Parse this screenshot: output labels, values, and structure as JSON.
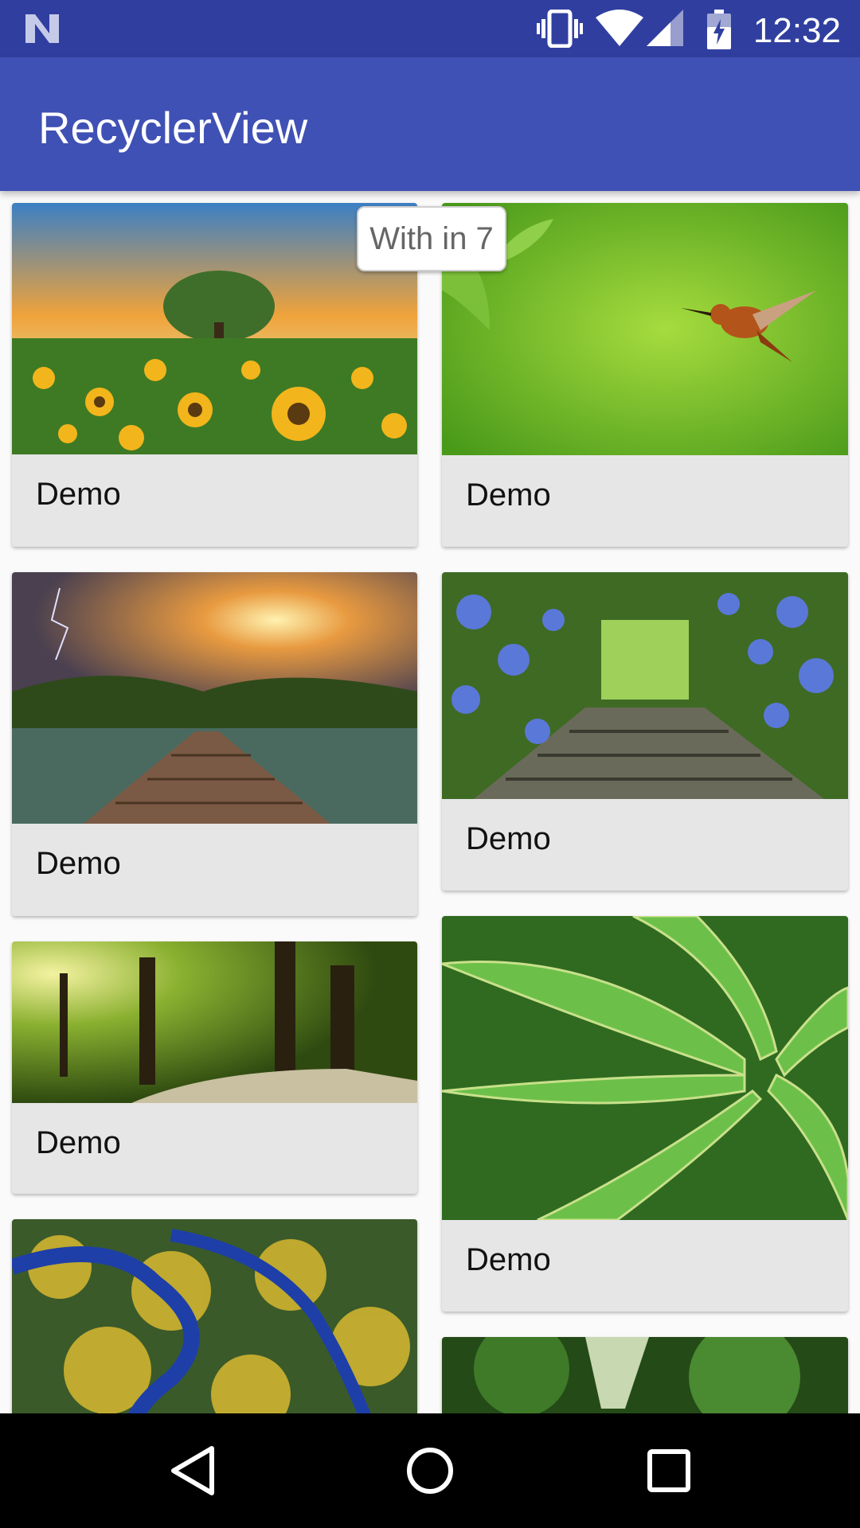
{
  "status_bar": {
    "time": "12:32",
    "icons": [
      "notification-n-icon",
      "vibrate-icon",
      "wifi-icon",
      "signal-icon",
      "battery-charging-icon"
    ]
  },
  "app_bar": {
    "title": "RecyclerView"
  },
  "cards": [
    {
      "label": "Demo",
      "image": "sunflower-field-tree-sunset"
    },
    {
      "label": "Demo",
      "image": "hummingbird-green-background"
    },
    {
      "label": "Demo",
      "image": "wooden-bridge-lake-sunset"
    },
    {
      "label": "Demo",
      "image": "blue-hydrangea-stairway"
    },
    {
      "label": "Demo",
      "image": "sunlit-forest-path"
    },
    {
      "label": "Demo",
      "image": "aloe-plant-closeup"
    },
    {
      "label": "",
      "image": "aerial-river-autumn"
    },
    {
      "label": "",
      "image": "green-forest-path"
    }
  ],
  "toast": {
    "text": "With in 7"
  },
  "nav_bar": {
    "buttons": [
      "back-icon",
      "home-icon",
      "recents-icon"
    ]
  }
}
